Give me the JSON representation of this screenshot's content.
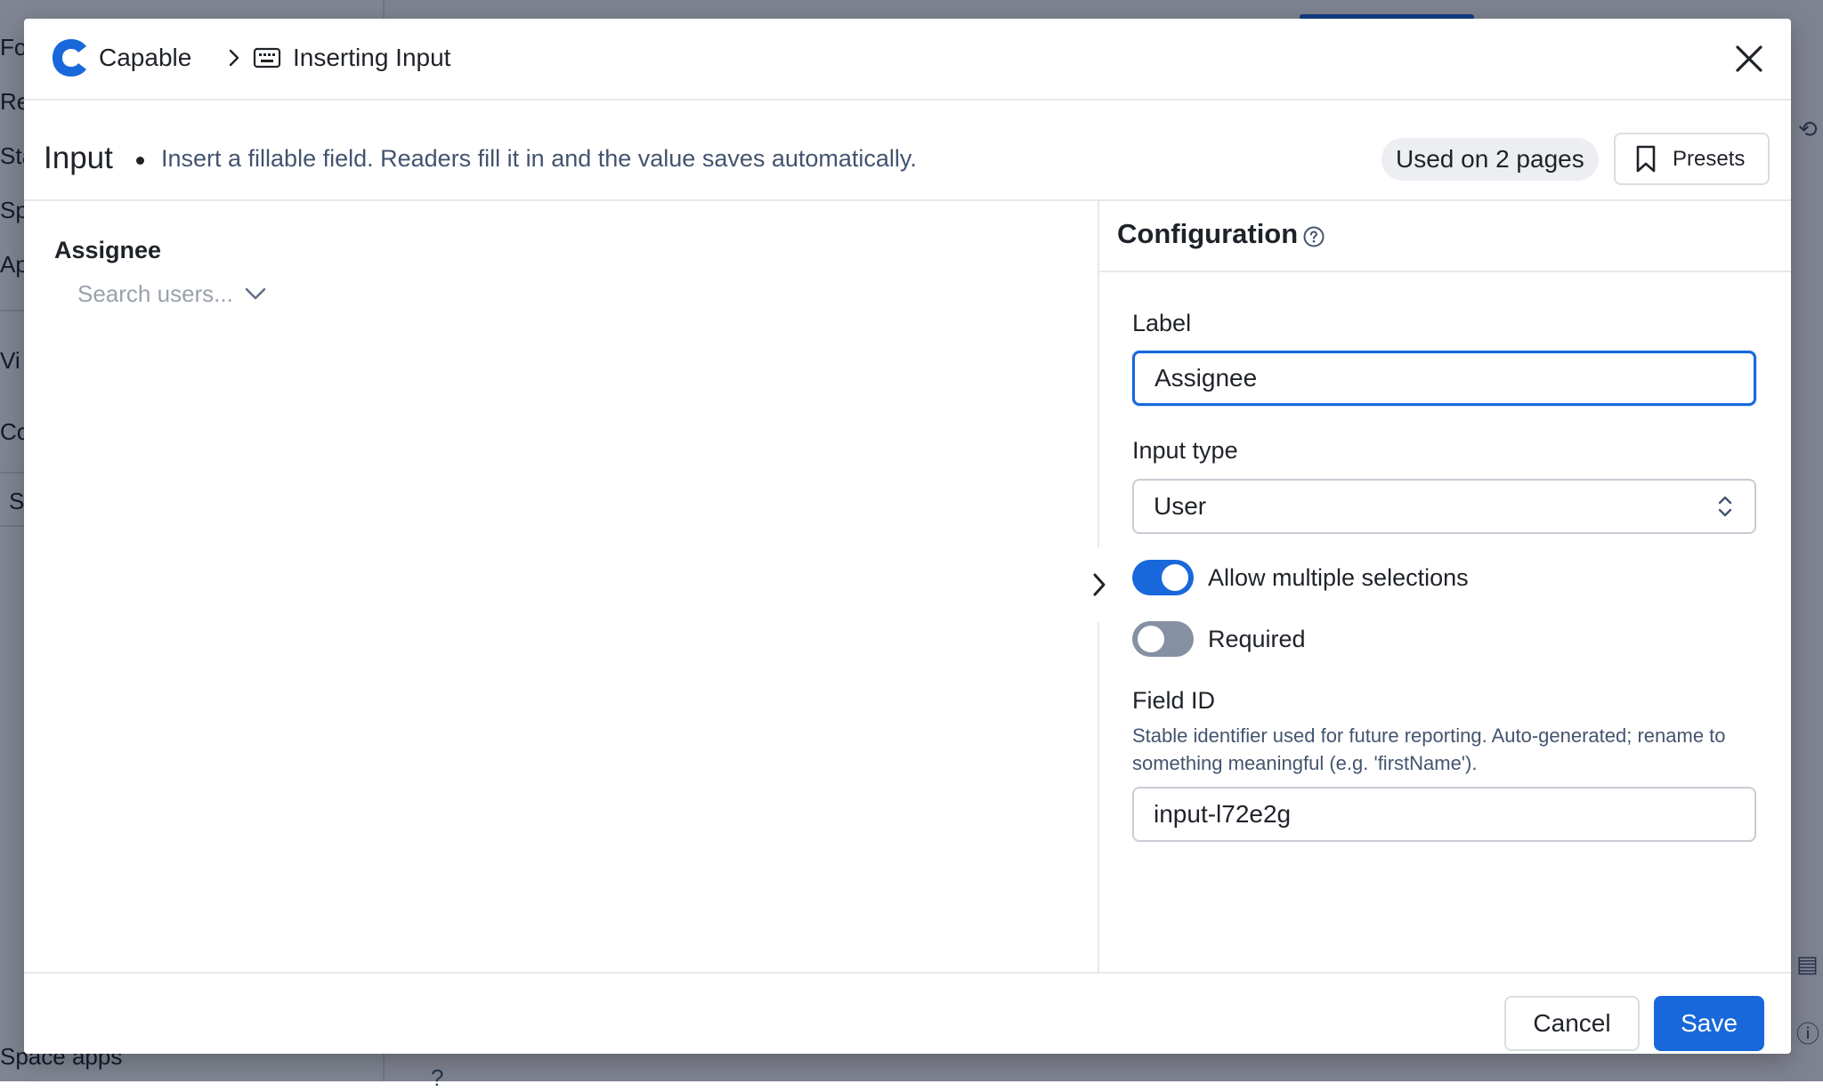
{
  "background": {
    "sidebar_items": [
      "Fo",
      "Re",
      "Sta",
      "Sp",
      "Ap",
      "Vi",
      "Co",
      "S"
    ],
    "sidebar_bottom_label": "Space apps",
    "overlay_color": "#09122a"
  },
  "modal": {
    "brand": "Capable",
    "breadcrumb_title": "Inserting Input",
    "icons": {
      "logo": "capable-logo-icon",
      "breadcrumb_separator": "chevron-right-icon",
      "breadcrumb_item": "keyboard-icon",
      "close": "close-icon"
    }
  },
  "header": {
    "title": "Input",
    "description": "Insert a fillable field. Readers fill it in and the value saves automatically.",
    "usage_badge": "Used on 2 pages",
    "presets_label": "Presets"
  },
  "preview": {
    "field_label": "Assignee",
    "placeholder": "Search users..."
  },
  "configuration": {
    "title": "Configuration",
    "label_field": {
      "label": "Label",
      "value": "Assignee"
    },
    "input_type": {
      "label": "Input type",
      "selected": "User"
    },
    "allow_multiple": {
      "label": "Allow multiple selections",
      "checked": true
    },
    "required": {
      "label": "Required",
      "checked": false
    },
    "field_id": {
      "label": "Field ID",
      "help": "Stable identifier used for future reporting. Auto-generated; rename to something meaningful (e.g. 'firstName').",
      "value": "input-l72e2g"
    }
  },
  "footer": {
    "cancel_label": "Cancel",
    "save_label": "Save"
  },
  "colors": {
    "accent": "#1868db",
    "toggle_off": "#8590a2"
  }
}
